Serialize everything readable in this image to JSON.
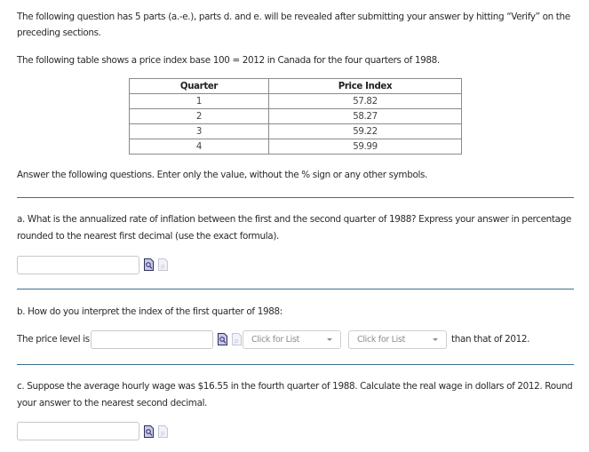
{
  "intro": {
    "line1": "The following question has 5 parts (a.-e.), parts d. and e. will be revealed after submitting your answer by hitting “Verify” on the",
    "line2": "preceding sections.",
    "table_intro": "The following table shows a price index base 100 = 2012 in Canada for the four quarters of 1988."
  },
  "table": {
    "headers": [
      "Quarter",
      "Price Index"
    ],
    "rows": [
      [
        "1",
        "57.82"
      ],
      [
        "2",
        "58.27"
      ],
      [
        "3",
        "59.22"
      ],
      [
        "4",
        "59.99"
      ]
    ]
  },
  "instructions": "Answer the following questions. Enter only the value, without the % sign or any other symbols.",
  "part_a": {
    "line1": "a. What is the annualized rate of inflation between the first and the second quarter of 1988? Express your answer in percentage",
    "line2": "rounded to the nearest first decimal (use the exact formula).",
    "answer_value": ""
  },
  "part_b": {
    "question": "b. How do you interpret the index of the first quarter of 1988:",
    "prefix": "The price level is",
    "answer_value": "",
    "dropdown1": "Click for List",
    "dropdown2": "Click for List",
    "suffix": "than that of 2012."
  },
  "part_c": {
    "line1": "c. Suppose the average hourly wage was $16.55 in the fourth quarter of 1988. Calculate the real wage in dollars of 2012. Round",
    "line2": "your answer to the nearest second decimal.",
    "answer_value": ""
  },
  "icons": {
    "preview": "document-magnifier-icon",
    "paste": "document-p-icon"
  },
  "colors": {
    "divider": "#3a6f8f",
    "text": "#2b2b2b"
  }
}
